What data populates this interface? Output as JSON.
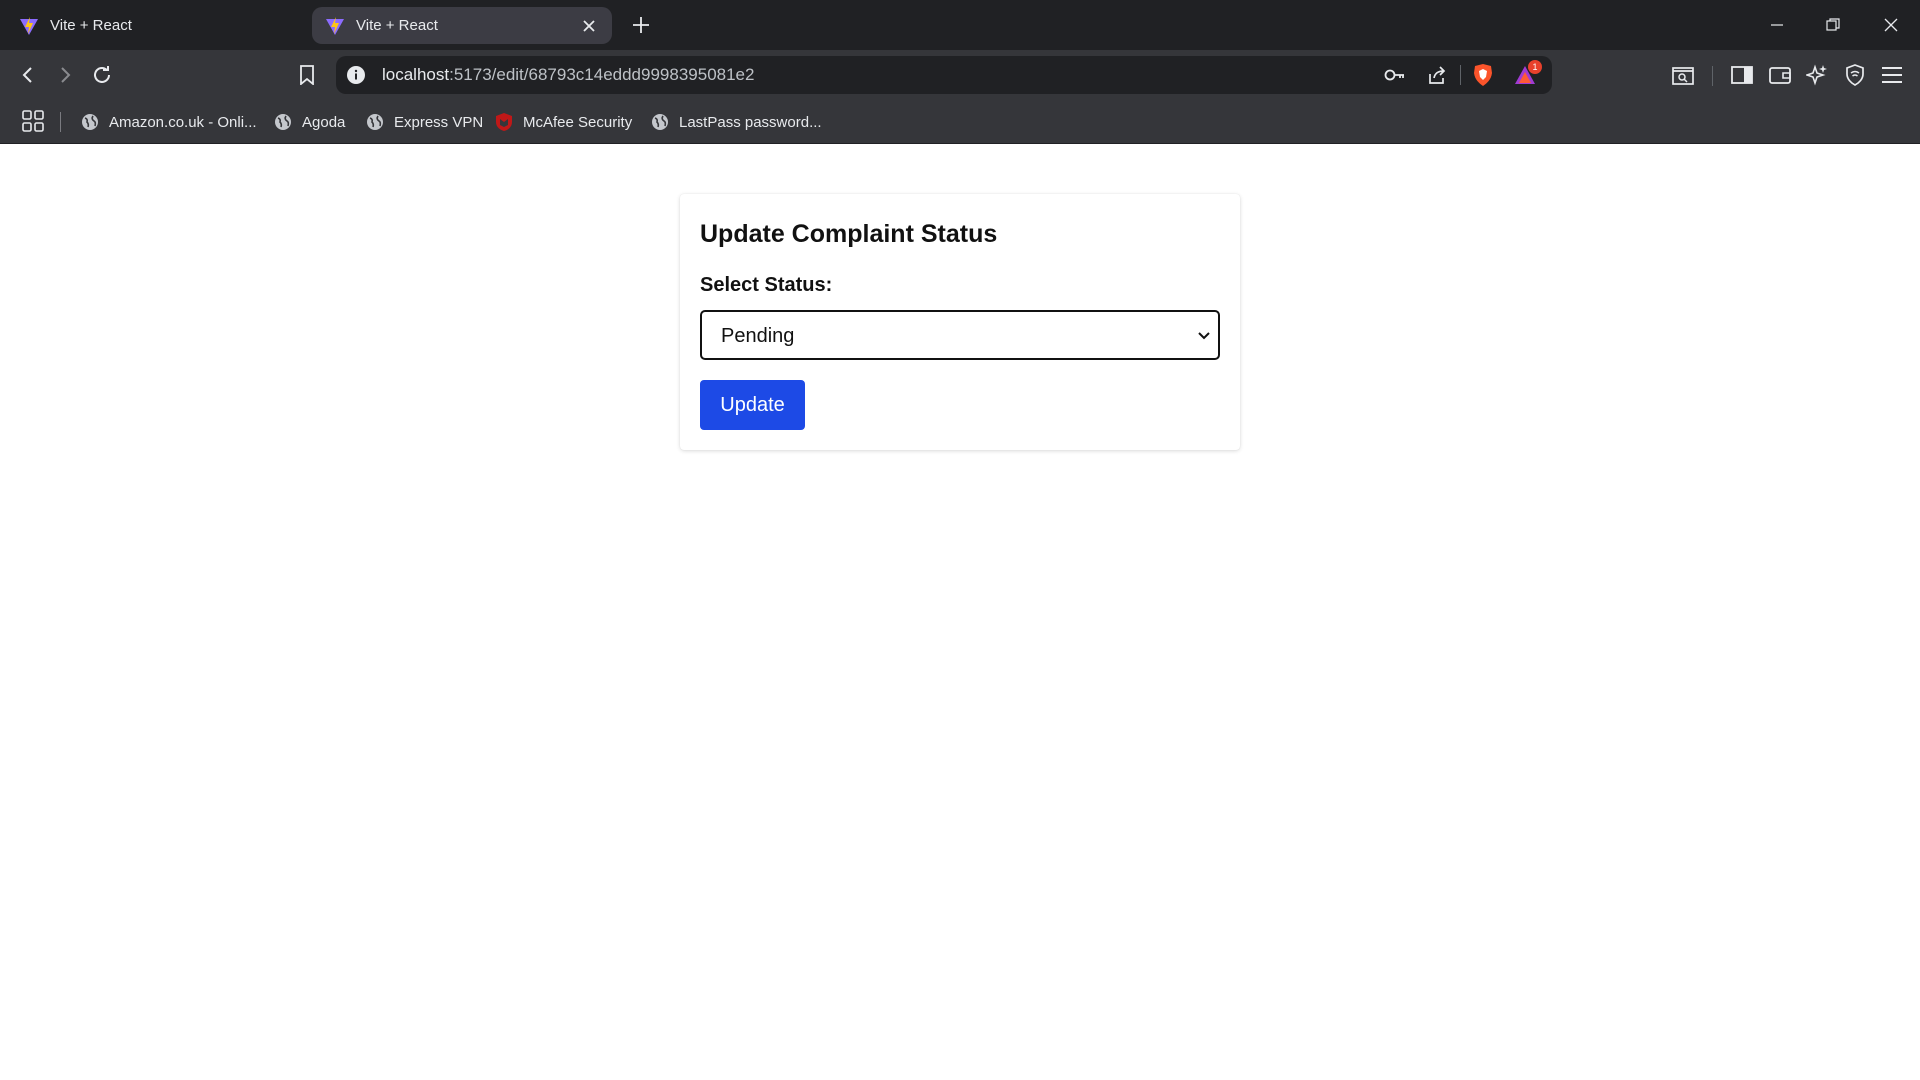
{
  "browser": {
    "tabs": [
      {
        "title": "Vite + React",
        "active": false
      },
      {
        "title": "Vite + React",
        "active": true
      }
    ],
    "url": {
      "host": "localhost",
      "path": ":5173/edit/68793c14eddd9998395081e2"
    },
    "notification_count": "1",
    "bookmarks": [
      {
        "label": "Amazon.co.uk - Onli...",
        "icon": "globe-icon"
      },
      {
        "label": "Agoda",
        "icon": "globe-icon"
      },
      {
        "label": "Express VPN",
        "icon": "globe-icon"
      },
      {
        "label": "McAfee Security",
        "icon": "mcafee-shield-icon"
      },
      {
        "label": "LastPass password...",
        "icon": "globe-icon"
      }
    ]
  },
  "form": {
    "title": "Update Complaint Status",
    "status_label": "Select Status:",
    "status_value": "Pending",
    "submit_label": "Update"
  },
  "colors": {
    "primary_button": "#1d4ae6",
    "browser_frame": "#202124",
    "toolbar": "#35363a"
  }
}
